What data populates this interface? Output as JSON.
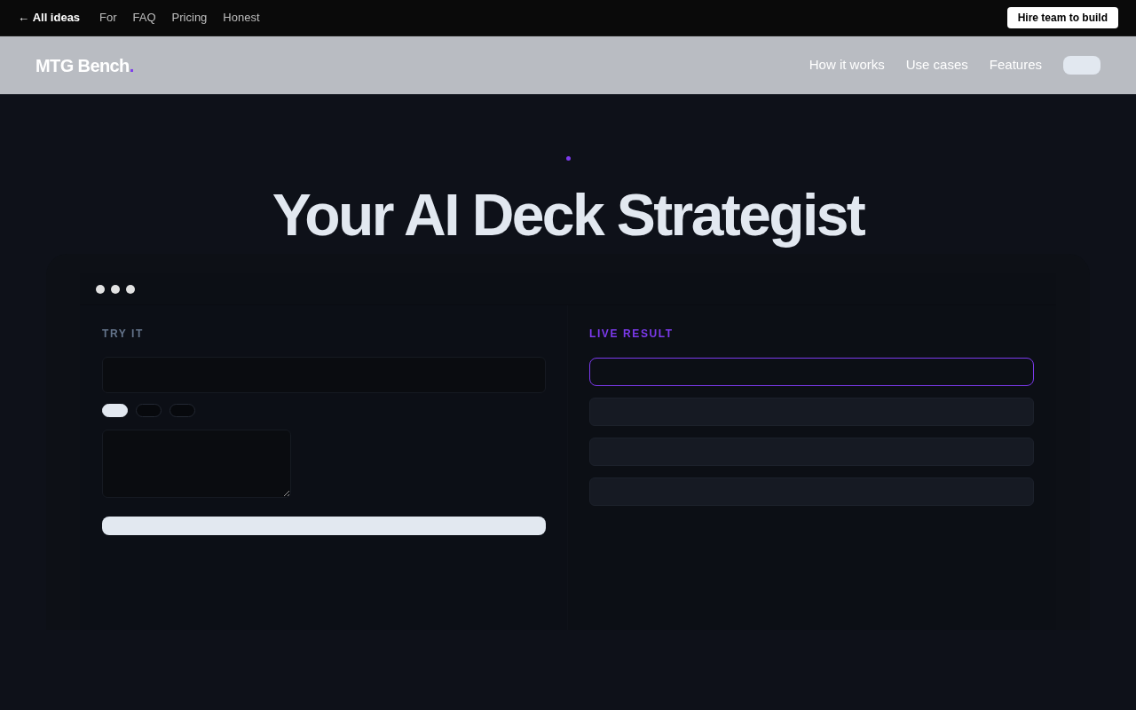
{
  "topbar": {
    "back_link": "← **All ideas**",
    "links": [
      "For",
      "FAQ",
      "Pricing",
      "Honest"
    ],
    "cta": "Hire team to build"
  },
  "header": {
    "logo": {
      "text": "MTG Bench",
      "accent": "."
    },
    "nav": [
      "How it works",
      "Use cases",
      "Features"
    ]
  },
  "hero": {
    "title": "Your AI Deck Strategist"
  },
  "demo": {
    "input_label": "TRY IT",
    "chips": [
      {
        "selected": true
      },
      {
        "selected": false
      },
      {
        "selected": false
      }
    ],
    "result_label": "LIVE RESULT"
  }
}
